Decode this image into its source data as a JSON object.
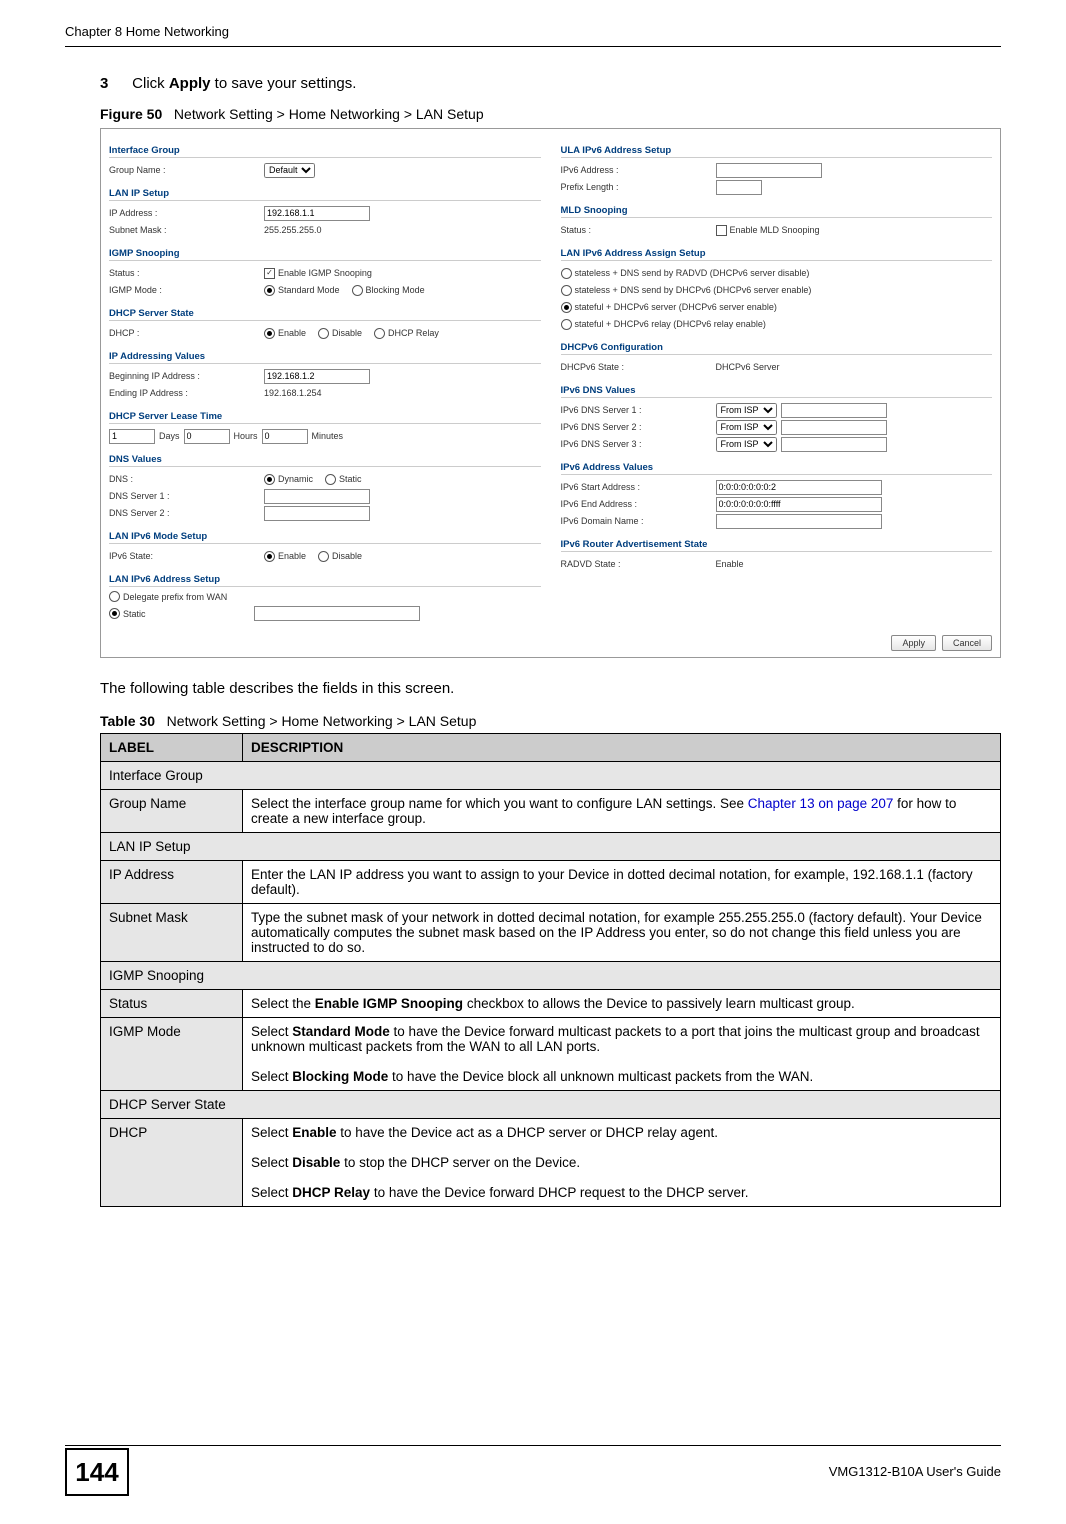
{
  "page": {
    "chapter_header": "Chapter 8 Home Networking",
    "page_number": "144",
    "guide_label": "VMG1312-B10A User's Guide"
  },
  "step": {
    "number": "3",
    "pre": "Click ",
    "bold": "Apply",
    "post": " to save your settings."
  },
  "figure": {
    "label": "Figure 50",
    "title": "Network Setting > Home Networking > LAN Setup"
  },
  "after_figure_text": "The following table describes the fields in this screen.",
  "table_caption": {
    "label": "Table 30",
    "title": "Network Setting > Home Networking > LAN Setup"
  },
  "table": {
    "headers": {
      "label": "LABEL",
      "description": "DESCRIPTION"
    },
    "rows": [
      {
        "full": "Interface Group"
      },
      {
        "label": "Group Name",
        "desc_pre": "Select the interface group name for which you want to configure LAN settings. See ",
        "link": "Chapter 13 on page 207",
        "desc_post": " for how to create a new interface group."
      },
      {
        "full": "LAN IP Setup"
      },
      {
        "label": "IP Address",
        "desc": "Enter the LAN IP address you want to assign to your Device in dotted decimal notation, for example, 192.168.1.1 (factory default)."
      },
      {
        "label": "Subnet Mask",
        "desc": "Type the subnet mask of your network in dotted decimal notation, for example 255.255.255.0 (factory default). Your Device automatically computes the subnet mask based on the IP Address you enter, so do not change this field unless you are instructed to do so."
      },
      {
        "full": "IGMP Snooping"
      },
      {
        "label": "Status",
        "desc_pre": "Select the ",
        "bold1": "Enable IGMP Snooping",
        "desc_mid": " checkbox to allows the Device to passively learn multicast group."
      },
      {
        "label": "IGMP Mode",
        "desc_pre": "Select ",
        "bold1": "Standard Mode",
        "desc_mid": " to have the Device forward multicast packets to a port that joins the multicast group and broadcast unknown multicast packets from the WAN to all LAN ports.",
        "para2_pre": "Select ",
        "para2_bold": "Blocking Mode",
        "para2_post": " to have the Device block all unknown multicast packets from the WAN."
      },
      {
        "full": "DHCP Server State"
      },
      {
        "label": "DHCP",
        "desc_pre": "Select ",
        "bold1": "Enable",
        "desc_mid": " to have the Device act as a DHCP server or DHCP relay agent.",
        "para2_pre": "Select ",
        "para2_bold": "Disable",
        "para2_post": " to stop the DHCP server on the Device.",
        "para3_pre": "Select ",
        "para3_bold": "DHCP Relay",
        "para3_post": " to have the Device forward DHCP request to the DHCP server."
      }
    ]
  },
  "screenshot": {
    "left": {
      "sect_interface": "Interface Group",
      "group_name_lbl": "Group Name :",
      "group_name_val": "Default",
      "sect_lanip": "LAN IP Setup",
      "ip_lbl": "IP Address :",
      "ip_val": "192.168.1.1",
      "subnet_lbl": "Subnet Mask :",
      "subnet_val": "255.255.255.0",
      "sect_igmp": "IGMP Snooping",
      "status_lbl": "Status :",
      "status_chk": "Enable IGMP Snooping",
      "mode_lbl": "IGMP Mode :",
      "mode_std": "Standard Mode",
      "mode_blk": "Blocking Mode",
      "sect_dhcp": "DHCP Server State",
      "dhcp_lbl": "DHCP :",
      "dhcp_en": "Enable",
      "dhcp_dis": "Disable",
      "dhcp_relay": "DHCP Relay",
      "sect_ipaddrvals": "IP Addressing Values",
      "begin_ip_lbl": "Beginning IP Address :",
      "begin_ip_val": "192.168.1.2",
      "end_ip_lbl": "Ending IP Address :",
      "end_ip_val": "192.168.1.254",
      "sect_lease": "DHCP Server Lease Time",
      "lease_days_val": "1",
      "lease_days_lbl": "Days",
      "lease_hours_val": "0",
      "lease_hours_lbl": "Hours",
      "lease_min_val": "0",
      "lease_min_lbl": "Minutes",
      "sect_dns": "DNS Values",
      "dns_lbl": "DNS :",
      "dns_dyn": "Dynamic",
      "dns_stat": "Static",
      "dns1_lbl": "DNS Server 1 :",
      "dns2_lbl": "DNS Server 2 :",
      "sect_v6mode": "LAN IPv6 Mode Setup",
      "v6state_lbl": "IPv6 State:",
      "v6_en": "Enable",
      "v6_dis": "Disable",
      "sect_v6addr": "LAN IPv6 Address Setup",
      "delegate_lbl": "Delegate prefix from WAN",
      "static_lbl": "Static"
    },
    "right": {
      "sect_ula": "ULA IPv6 Address Setup",
      "v6addr_lbl": "IPv6 Address :",
      "prefix_lbl": "Prefix Length :",
      "sect_mld": "MLD Snooping",
      "mld_status_lbl": "Status :",
      "mld_chk": "Enable MLD Snooping",
      "sect_v6assign": "LAN IPv6 Address Assign Setup",
      "assign_opt1": "stateless + DNS send by RADVD (DHCPv6 server disable)",
      "assign_opt2": "stateless + DNS send by DHCPv6 (DHCPv6 server enable)",
      "assign_opt3": "stateful + DHCPv6 server (DHCPv6 server enable)",
      "assign_opt4": "stateful + DHCPv6 relay (DHCPv6 relay enable)",
      "sect_v6conf": "DHCPv6 Configuration",
      "v6conf_lbl": "DHCPv6 State :",
      "v6conf_val": "DHCPv6 Server",
      "sect_v6dns": "IPv6 DNS Values",
      "v6dns1_lbl": "IPv6 DNS Server 1 :",
      "v6dns2_lbl": "IPv6 DNS Server 2 :",
      "v6dns3_lbl": "IPv6 DNS Server 3 :",
      "v6dns_opt": "From ISP",
      "sect_v6vals": "IPv6 Address Values",
      "v6start_lbl": "IPv6 Start Address :",
      "v6start_val": "0:0:0:0:0:0:0:2",
      "v6end_lbl": "IPv6 End Address :",
      "v6end_val": "0:0:0:0:0:0:0:ffff",
      "v6domain_lbl": "IPv6 Domain Name :",
      "sect_radvd": "IPv6 Router Advertisement State",
      "radvd_lbl": "RADVD State :",
      "radvd_val": "Enable"
    },
    "buttons": {
      "apply": "Apply",
      "cancel": "Cancel"
    }
  }
}
